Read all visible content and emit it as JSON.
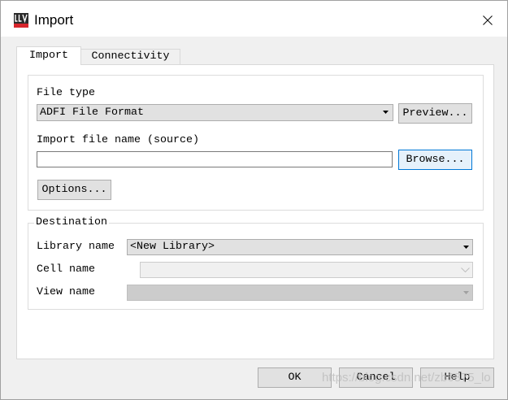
{
  "window": {
    "title": "Import",
    "app_icon": "app-icon",
    "close_icon": "close-icon"
  },
  "tabs": [
    {
      "label": "Import",
      "selected": true
    },
    {
      "label": "Connectivity",
      "selected": false
    }
  ],
  "source": {
    "file_type_label": "File type",
    "file_type_value": "ADFI File Format",
    "preview_label": "Preview...",
    "file_name_label": "Import file name (source)",
    "file_name_value": "",
    "browse_label": "Browse...",
    "options_label": "Options..."
  },
  "destination": {
    "legend": "Destination",
    "library_label": "Library name",
    "library_value": "<New Library>",
    "cell_label": "Cell name",
    "cell_value": "",
    "cell_enabled": false,
    "view_label": "View name",
    "view_value": "",
    "view_enabled": false
  },
  "footer": {
    "ok_label": "OK",
    "cancel_label": "Cancel",
    "help_label": "Help"
  },
  "watermark": "https://blog.csdn.net/zb6875_lo",
  "icons": {
    "dropdown": "dropdown-arrow-icon",
    "combo_chevron": "chevron-down-icon"
  },
  "colors": {
    "focus_accent": "#0078d7",
    "brand_red": "#d7252c"
  }
}
